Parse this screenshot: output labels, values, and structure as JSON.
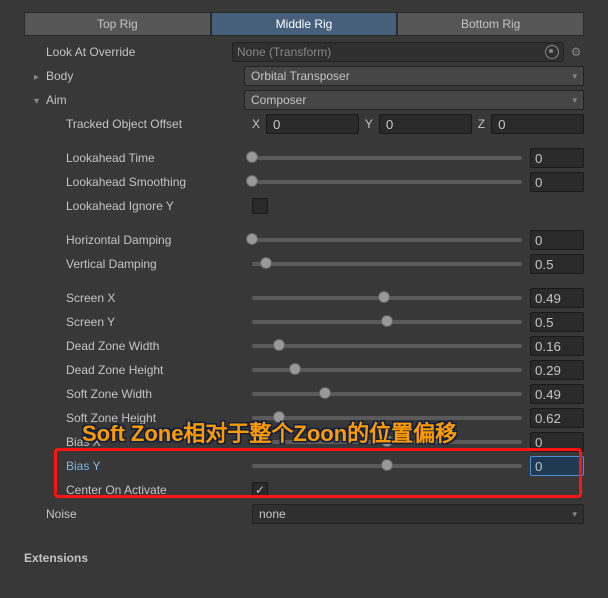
{
  "tabs": {
    "top": "Top Rig",
    "middle": "Middle Rig",
    "bottom": "Bottom Rig"
  },
  "lookAtOverride": {
    "label": "Look At Override",
    "value": "None (Transform)"
  },
  "body": {
    "label": "Body",
    "value": "Orbital Transposer"
  },
  "aim": {
    "label": "Aim",
    "value": "Composer"
  },
  "trackedOffset": {
    "label": "Tracked Object Offset",
    "x": "0",
    "y": "0",
    "z": "0"
  },
  "lookahead": {
    "time": {
      "label": "Lookahead Time",
      "val": "0",
      "pct": 0
    },
    "smoothing": {
      "label": "Lookahead Smoothing",
      "val": "0",
      "pct": 0
    },
    "ignoreY": {
      "label": "Lookahead Ignore Y",
      "checked": false
    }
  },
  "damping": {
    "horizontal": {
      "label": "Horizontal Damping",
      "val": "0",
      "pct": 0
    },
    "vertical": {
      "label": "Vertical Damping",
      "val": "0.5",
      "pct": 5
    }
  },
  "screen": {
    "x": {
      "label": "Screen X",
      "val": "0.49",
      "pct": 49
    },
    "y": {
      "label": "Screen Y",
      "val": "0.5",
      "pct": 50
    },
    "dzw": {
      "label": "Dead Zone Width",
      "val": "0.16",
      "pct": 10
    },
    "dzh": {
      "label": "Dead Zone Height",
      "val": "0.29",
      "pct": 16
    },
    "szw": {
      "label": "Soft Zone Width",
      "val": "0.49",
      "pct": 27
    },
    "szh": {
      "label": "Soft Zone Height",
      "val": "0.62",
      "pct": 10
    },
    "bx": {
      "label": "Bias X",
      "val": "0",
      "pct": 50
    },
    "by": {
      "label": "Bias Y",
      "val": "0",
      "pct": 50
    }
  },
  "centerOnActivate": {
    "label": "Center On Activate",
    "checked": true
  },
  "noise": {
    "label": "Noise",
    "value": "none"
  },
  "extensions": {
    "label": "Extensions"
  },
  "axes": {
    "x": "X",
    "y": "Y",
    "z": "Z"
  },
  "annotation": "Soft Zone相对于整个Zoon的位置偏移"
}
